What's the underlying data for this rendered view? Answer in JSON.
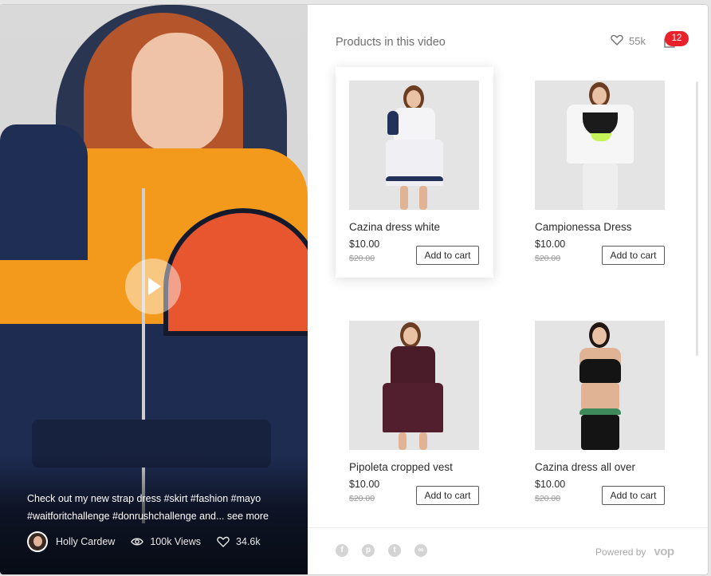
{
  "video": {
    "caption": "Check out my new  strap dress #skirt #fashion #mayo #waitforitchallenge #donrushchallenge and...",
    "see_more": "see more",
    "author": "Holly Cardew",
    "views": "100k Views",
    "likes": "34.6k"
  },
  "panel": {
    "title": "Products in this video",
    "likes": "55k",
    "cart_count": "12"
  },
  "products": [
    {
      "name": "Cazina dress white",
      "price": "$10.00",
      "old_price": "$20.00",
      "button": "Add to cart"
    },
    {
      "name": "Campionessa Dress",
      "price": "$10.00",
      "old_price": "$20.00",
      "button": "Add to cart"
    },
    {
      "name": "Pipoleta cropped vest",
      "price": "$10.00",
      "old_price": "$20.00",
      "button": "Add to cart"
    },
    {
      "name": "Cazina dress all over",
      "price": "$10.00",
      "old_price": "$20.00",
      "button": "Add to cart"
    }
  ],
  "footer": {
    "powered_by": "Powered by",
    "brand": "vop",
    "socials": [
      "facebook-icon",
      "pinterest-icon",
      "twitter-icon",
      "link-icon"
    ]
  },
  "colors": {
    "badge": "#e8212b",
    "jacket_orange": "#f39a1c",
    "jacket_navy": "#1e2c52"
  }
}
